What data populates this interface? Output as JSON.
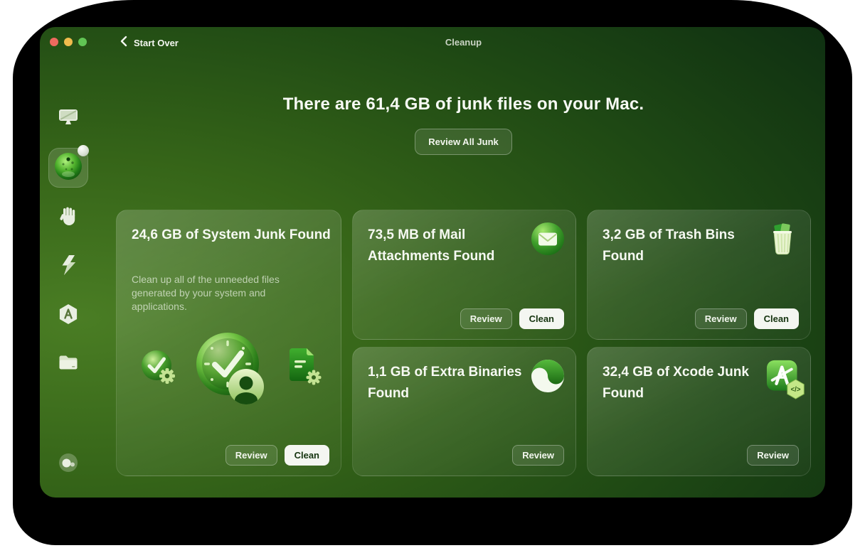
{
  "titlebar": {
    "back_label": "Start Over",
    "title": "Cleanup"
  },
  "hero": {
    "headline": "There are 61,4 GB of junk files on your Mac.",
    "review_all_label": "Review All Junk"
  },
  "sidebar": {
    "items": [
      {
        "icon": "mac-display"
      },
      {
        "icon": "cleanup-ball",
        "active": true,
        "badge": true
      },
      {
        "icon": "protection-hand"
      },
      {
        "icon": "speed-lightning"
      },
      {
        "icon": "applications-seal"
      },
      {
        "icon": "files-folder"
      },
      {
        "icon": "assistant-orb"
      }
    ]
  },
  "cards": [
    {
      "title": "24,6 GB of System Junk Found",
      "description": "Clean up all of the unneeded files generated by your system and applications.",
      "icons": [
        "clock-gear",
        "clock-user",
        "document-gear"
      ],
      "review_label": "Review",
      "clean_label": "Clean"
    },
    {
      "title": "73,5 MB of Mail Attachments Found",
      "icon": "mail-badge",
      "review_label": "Review",
      "clean_label": "Clean"
    },
    {
      "title": "3,2 GB of Trash Bins Found",
      "icon": "trash-bin",
      "review_label": "Review",
      "clean_label": "Clean"
    },
    {
      "title": "1,1 GB of Extra Binaries Found",
      "icon": "binaries-yin-yang",
      "review_label": "Review"
    },
    {
      "title": "32,4 GB of Xcode Junk Found",
      "icon": "xcode-app",
      "icon_badge_code": "</>",
      "review_label": "Review"
    }
  ],
  "colors": {
    "window_dark": "#0c2b10",
    "window_light": "#4a7d24",
    "traffic_close": "#ee6a5f",
    "traffic_minimize": "#f0bb4d",
    "traffic_zoom": "#61c554",
    "clean_button_bg": "#f4f6f1",
    "clean_button_text": "#15340f"
  }
}
